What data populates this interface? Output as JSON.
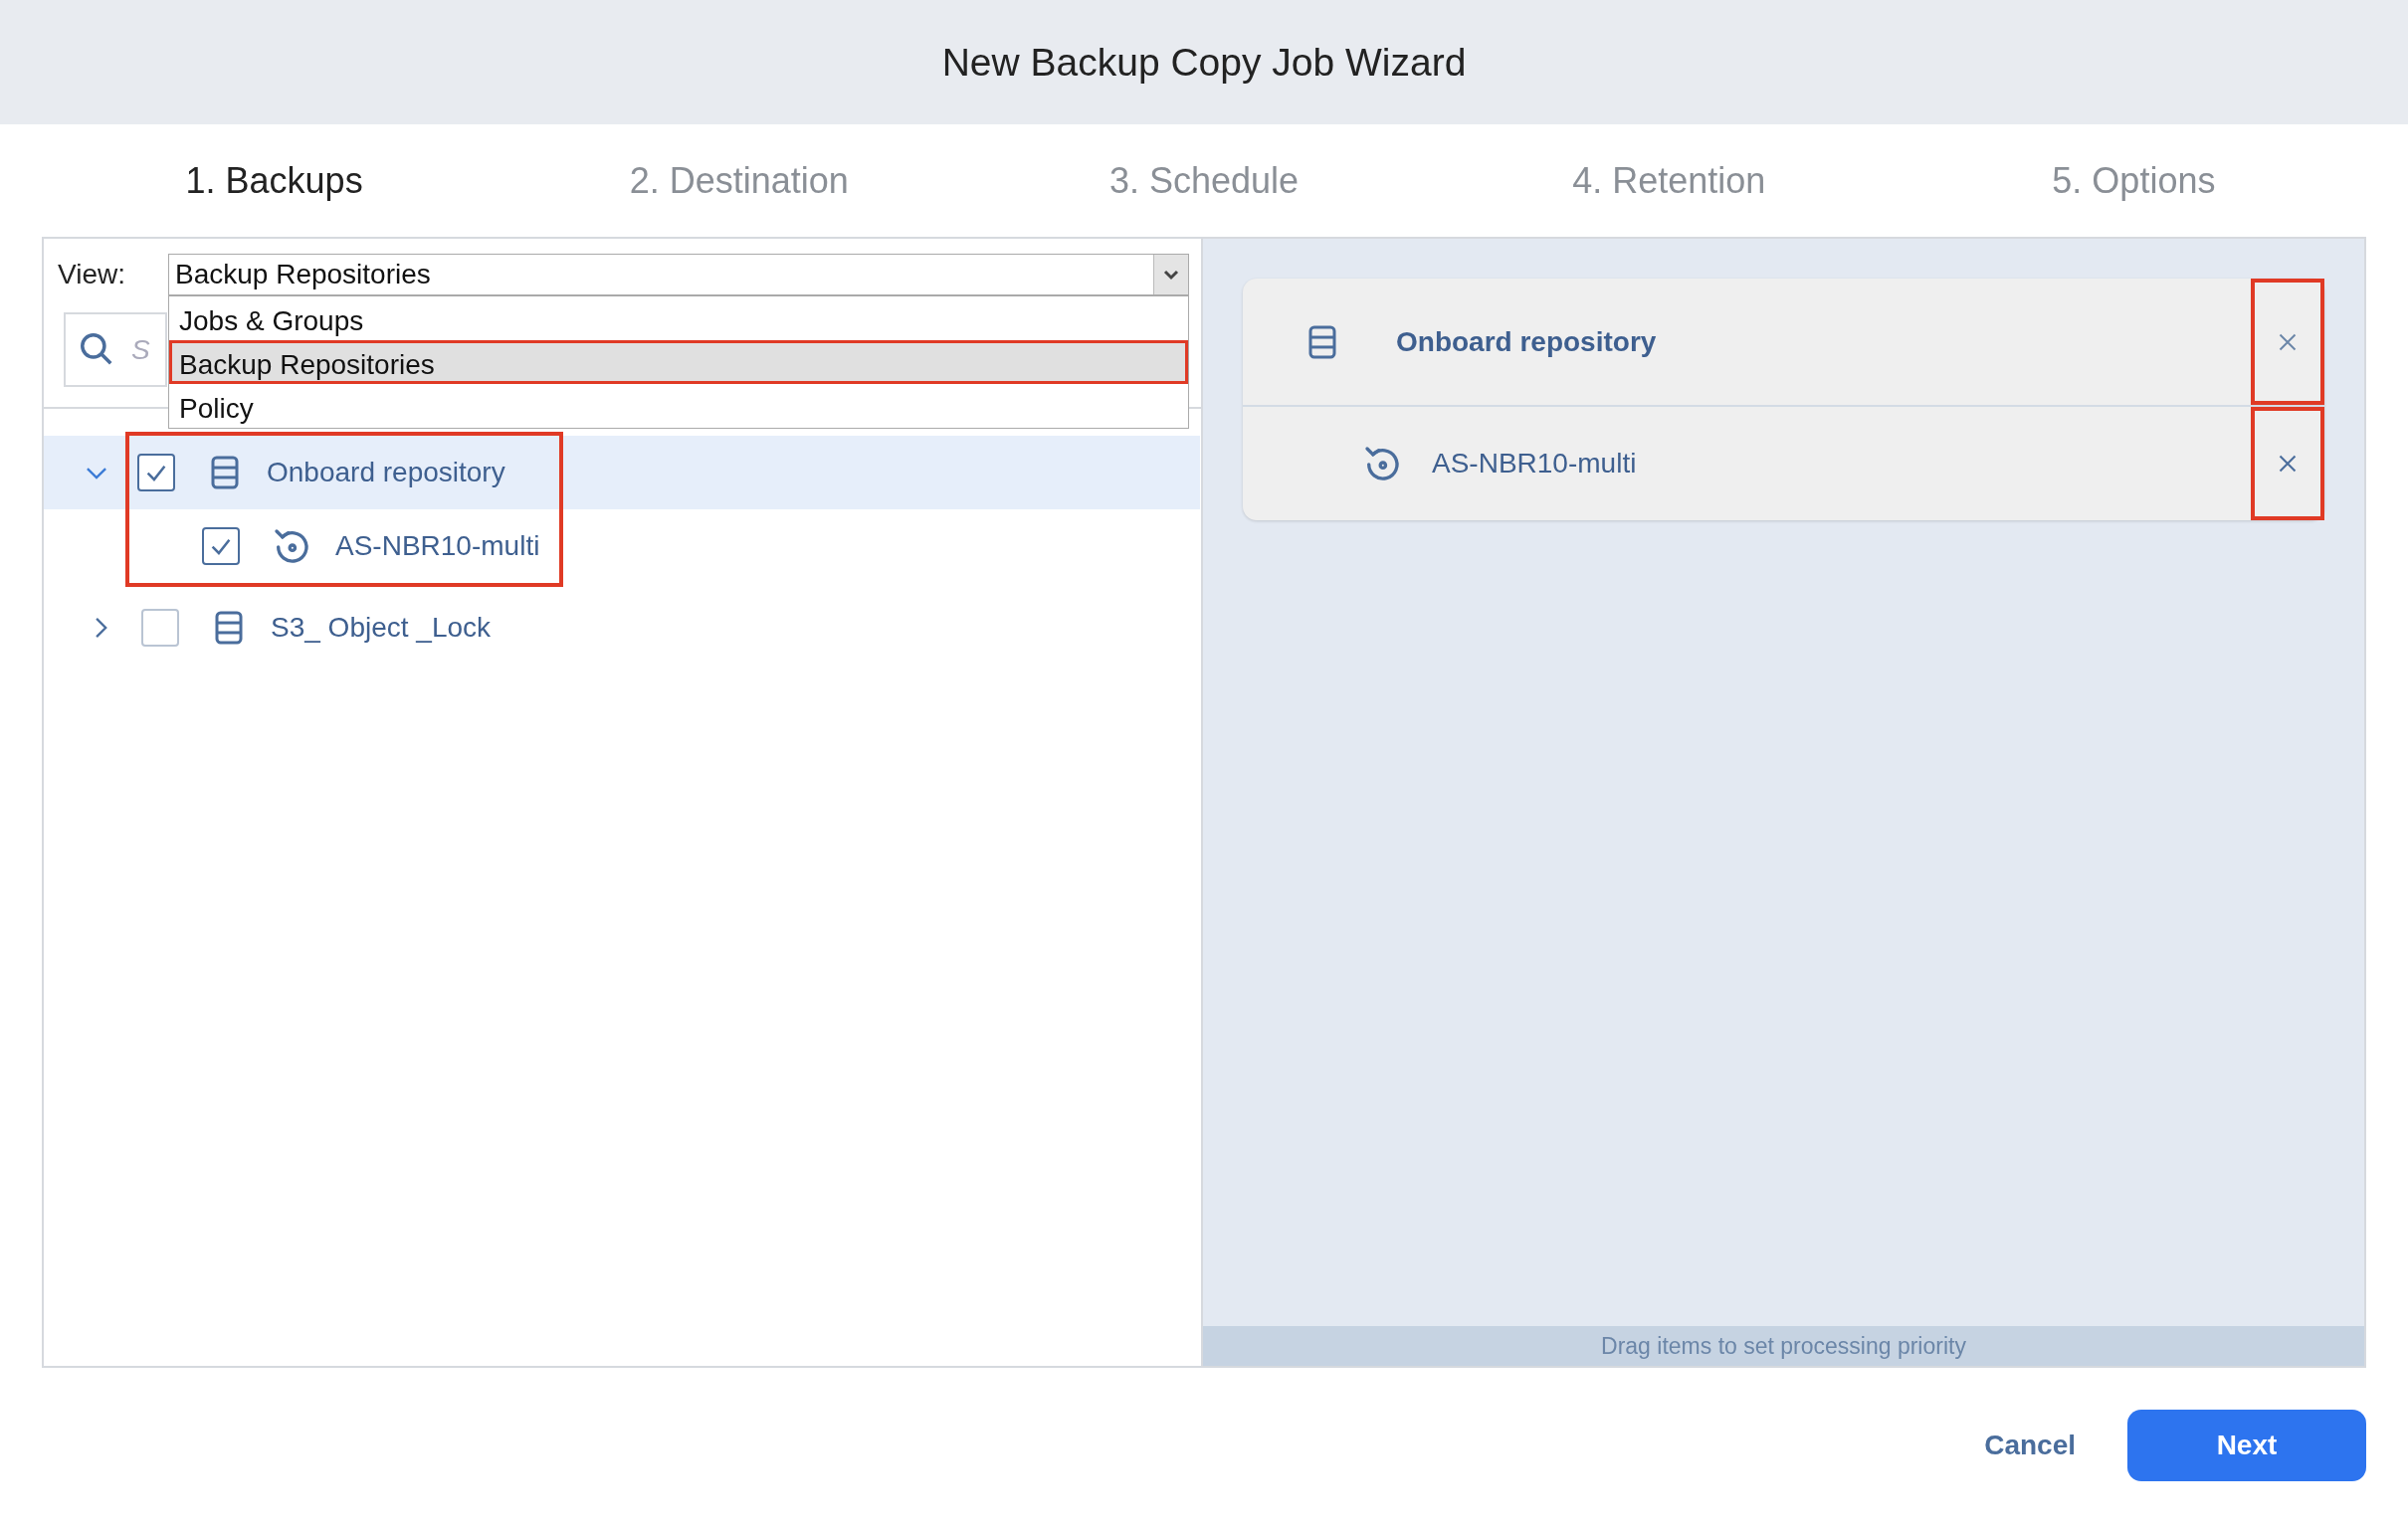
{
  "window": {
    "title": "New Backup Copy Job Wizard"
  },
  "steps": [
    {
      "label": "1. Backups",
      "selected": true
    },
    {
      "label": "2. Destination",
      "selected": false
    },
    {
      "label": "3. Schedule",
      "selected": false
    },
    {
      "label": "4. Retention",
      "selected": false
    },
    {
      "label": "5. Options",
      "selected": false
    }
  ],
  "view": {
    "label": "View:",
    "value": "Backup Repositories",
    "expanded": true,
    "options": [
      {
        "label": "Jobs & Groups",
        "selected": false,
        "highlighted": false
      },
      {
        "label": "Backup Repositories",
        "selected": true,
        "highlighted": true
      },
      {
        "label": "Policy",
        "selected": false,
        "highlighted": false
      }
    ]
  },
  "search": {
    "placeholder": "S"
  },
  "tree": [
    {
      "label": "Onboard repository",
      "kind": "repository",
      "expanded": true,
      "checked": true,
      "selected": true,
      "highlighted": true,
      "children": [
        {
          "label": "AS-NBR10-multi",
          "kind": "backup",
          "checked": true,
          "selected": false
        }
      ]
    },
    {
      "label": "S3_ Object _Lock",
      "kind": "repository",
      "expanded": false,
      "checked": false,
      "selected": false,
      "highlighted": false
    }
  ],
  "selected_items": [
    {
      "label": "Onboard repository",
      "kind": "repository",
      "highlighted": true,
      "children": [
        {
          "label": "AS-NBR10-multi",
          "kind": "backup",
          "highlighted": true
        }
      ]
    }
  ],
  "hint": "Drag items to set processing priority",
  "buttons": {
    "cancel": "Cancel",
    "next": "Next"
  }
}
